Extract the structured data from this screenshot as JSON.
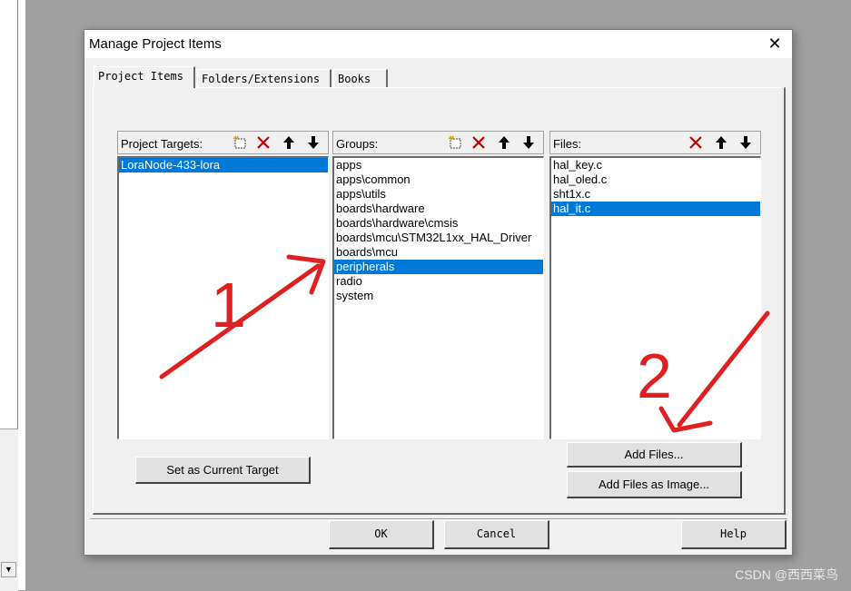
{
  "dialog": {
    "title": "Manage Project Items",
    "close_label": "✕",
    "tabs": [
      {
        "label": "Project Items",
        "active": true
      },
      {
        "label": "Folders/Extensions",
        "active": false
      },
      {
        "label": "Books",
        "active": false
      }
    ]
  },
  "targets": {
    "header": "Project Targets:",
    "items": [
      "LoraNode-433-lora"
    ],
    "selected_index": 0
  },
  "groups": {
    "header": "Groups:",
    "items": [
      "apps",
      "apps\\common",
      "apps\\utils",
      "boards\\hardware",
      "boards\\hardware\\cmsis",
      "boards\\mcu\\STM32L1xx_HAL_Driver",
      "boards\\mcu",
      "peripherals",
      "radio",
      "system"
    ],
    "selected_index": 7
  },
  "files": {
    "header": "Files:",
    "items": [
      "hal_key.c",
      "hal_oled.c",
      "sht1x.c",
      "hal_it.c"
    ],
    "selected_index": 3
  },
  "buttons": {
    "set_current_target": "Set as Current Target",
    "add_files": "Add Files...",
    "add_files_image": "Add Files as Image...",
    "ok": "OK",
    "cancel": "Cancel",
    "help": "Help"
  },
  "annotations": {
    "label_1": "1",
    "label_2": "2",
    "color": "#e02020"
  },
  "watermark": "CSDN @西西菜鸟",
  "colors": {
    "selection": "#0078d7",
    "delete_icon": "#c00000"
  }
}
